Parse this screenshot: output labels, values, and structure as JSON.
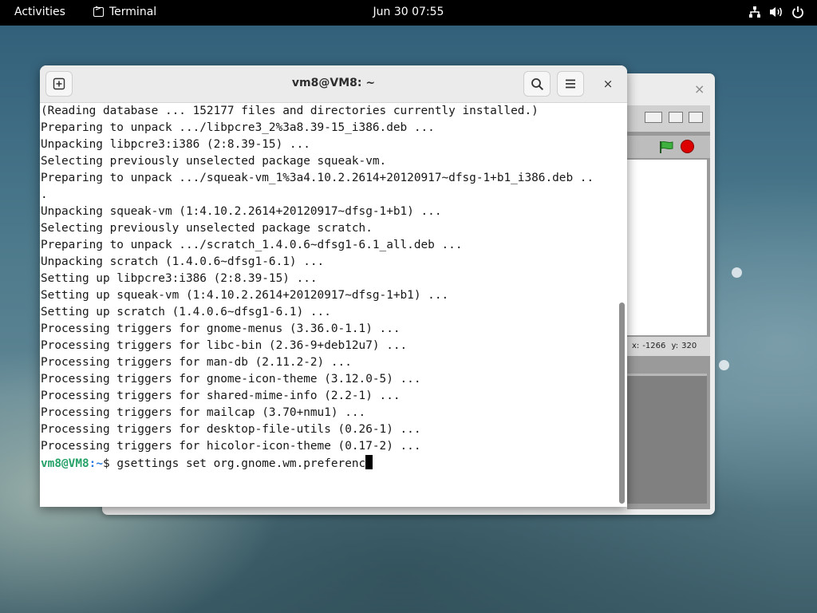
{
  "topbar": {
    "activities": "Activities",
    "app_name": "Terminal",
    "clock": "Jun 30  07:55",
    "tray_icons": [
      "network-icon",
      "volume-icon",
      "power-icon"
    ]
  },
  "back_window": {
    "close_symbol": "×",
    "coords": {
      "x_label": "x:",
      "x_value": "-1266",
      "y_label": "y:",
      "y_value": "320"
    }
  },
  "terminal": {
    "title": "vm8@VM8: ~",
    "close_symbol": "×",
    "output_lines": [
      "(Reading database ... 152177 files and directories currently installed.)",
      "Preparing to unpack .../libpcre3_2%3a8.39-15_i386.deb ...",
      "Unpacking libpcre3:i386 (2:8.39-15) ...",
      "Selecting previously unselected package squeak-vm.",
      "Preparing to unpack .../squeak-vm_1%3a4.10.2.2614+20120917~dfsg-1+b1_i386.deb ..",
      ".",
      "Unpacking squeak-vm (1:4.10.2.2614+20120917~dfsg-1+b1) ...",
      "Selecting previously unselected package scratch.",
      "Preparing to unpack .../scratch_1.4.0.6~dfsg1-6.1_all.deb ...",
      "Unpacking scratch (1.4.0.6~dfsg1-6.1) ...",
      "Setting up libpcre3:i386 (2:8.39-15) ...",
      "Setting up squeak-vm (1:4.10.2.2614+20120917~dfsg-1+b1) ...",
      "Setting up scratch (1.4.0.6~dfsg1-6.1) ...",
      "Processing triggers for gnome-menus (3.36.0-1.1) ...",
      "Processing triggers for libc-bin (2.36-9+deb12u7) ...",
      "Processing triggers for man-db (2.11.2-2) ...",
      "Processing triggers for gnome-icon-theme (3.12.0-5) ...",
      "Processing triggers for shared-mime-info (2.2-1) ...",
      "Processing triggers for mailcap (3.70+nmu1) ...",
      "Processing triggers for desktop-file-utils (0.26-1) ...",
      "Processing triggers for hicolor-icon-theme (0.17-2) ..."
    ],
    "prompt": {
      "user_host": "vm8@VM8",
      "path": ":~",
      "symbol": "$ ",
      "command": "gsettings set org.gnome.wm.preferenc"
    }
  }
}
